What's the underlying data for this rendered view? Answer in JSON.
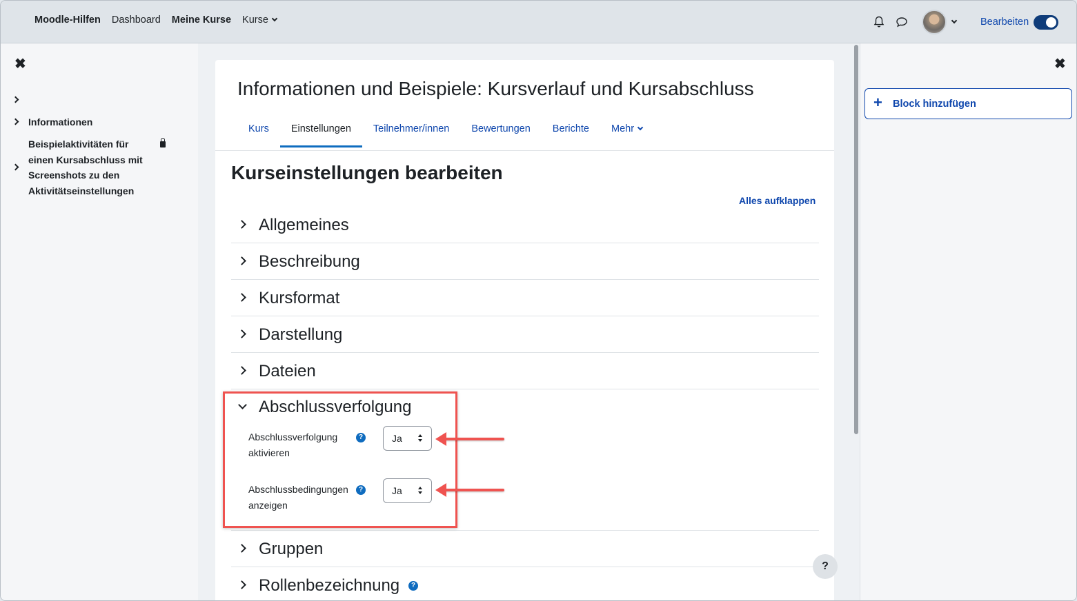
{
  "navbar": {
    "brand": "Moodle-Hilfen",
    "links": [
      "Dashboard",
      "Meine Kurse",
      "Kurse"
    ],
    "edit_mode_label": "Bearbeiten"
  },
  "course_index": {
    "items": [
      "",
      "Informationen",
      "Beispielaktivitäten für einen Kursabschluss mit Screenshots zu den Aktivitätseinstellungen"
    ]
  },
  "page": {
    "title": "Informationen und Beispiele: Kursverlauf und Kursabschluss",
    "tabs": [
      "Kurs",
      "Einstellungen",
      "Teilnehmer/innen",
      "Bewertungen",
      "Berichte",
      "Mehr"
    ],
    "active_tab": "Einstellungen",
    "heading": "Kurseinstellungen bearbeiten",
    "expand_all": "Alles aufklappen"
  },
  "sections": [
    "Allgemeines",
    "Beschreibung",
    "Kursformat",
    "Darstellung",
    "Dateien",
    "Abschlussverfolgung",
    "Gruppen",
    "Rollenbezeichnung"
  ],
  "completion": {
    "field1_label": [
      "Abschlussverfolgung",
      "aktivieren"
    ],
    "field1_value": "Ja",
    "field2_label": [
      "Abschlussbedingungen",
      "anzeigen"
    ],
    "field2_value": "Ja"
  },
  "right_drawer": {
    "add_block": "Block hinzufügen"
  },
  "help_button": "?",
  "colors": {
    "link": "#0f47ad",
    "highlight": "#ef5350",
    "toggle": "#0f3c7a"
  }
}
